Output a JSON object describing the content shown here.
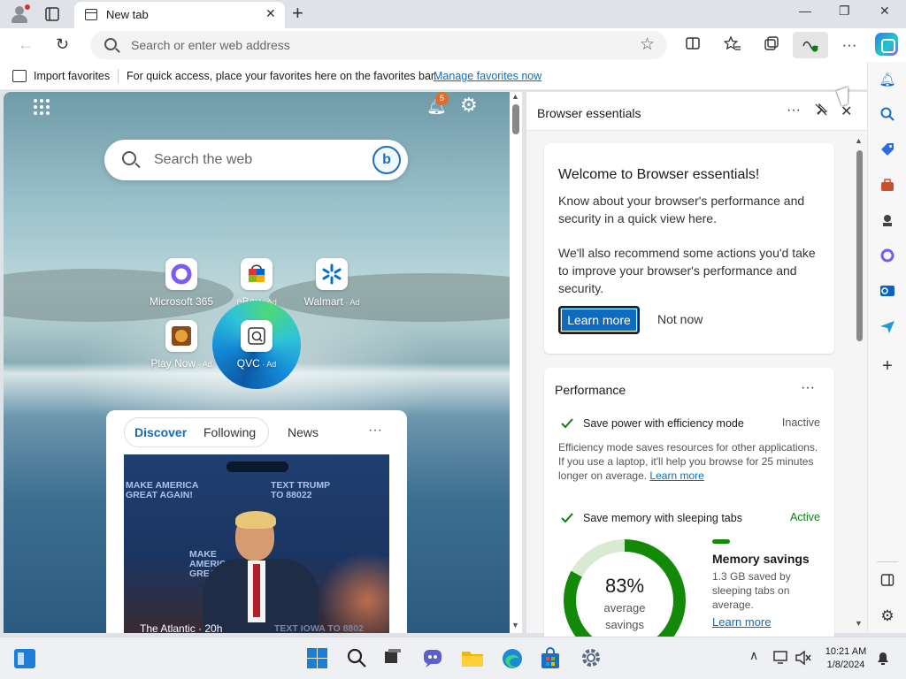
{
  "window": {
    "tab_title": "New tab",
    "new_tab_glyph": "+",
    "close_glyph": "✕",
    "minimize_glyph": "—",
    "maximize_glyph": "❐"
  },
  "toolbar": {
    "back_glyph": "←",
    "refresh_glyph": "↻",
    "address_placeholder": "Search or enter web address",
    "favorite_glyph": "☆",
    "more_glyph": "···"
  },
  "favorites_bar": {
    "import_label": "Import favorites",
    "message": "For quick access, place your favorites here on the favorites bar.",
    "manage_link": "Manage favorites now"
  },
  "new_tab_page": {
    "notification_count": "5",
    "search_placeholder": "Search the web",
    "bing_glyph": "b",
    "quick_links": [
      {
        "label": "Microsoft 365",
        "ad": ""
      },
      {
        "label": "eBay",
        "ad": " · Ad"
      },
      {
        "label": "Walmart",
        "ad": " · Ad"
      },
      {
        "label": "Play Now",
        "ad": " · Ad"
      },
      {
        "label": "QVC",
        "ad": " · Ad"
      }
    ],
    "feed_tabs": [
      "Discover",
      "Following",
      "News"
    ],
    "feed_more": "···",
    "story": {
      "source": "The Atlantic · 20h",
      "poster_1": "MAKE AMERICA GREAT AGAIN!",
      "poster_2": "TEXT TRUMP TO 88022",
      "poster_3": "MAKE AMERICA GREAT A",
      "poster_4": "TEXT IOWA TO 8802"
    }
  },
  "browser_essentials": {
    "title": "Browser essentials",
    "more_glyph": "···",
    "welcome": {
      "title": "Welcome to Browser essentials!",
      "text_1": "Know about your browser's performance and security in a quick view here.",
      "text_2": "We'll also recommend some actions you'd take to improve your browser's performance and security.",
      "learn_more": "Learn more",
      "not_now": "Not now"
    },
    "performance": {
      "title": "Performance",
      "efficiency": {
        "name": "Save power with efficiency mode",
        "status": "Inactive",
        "desc": "Efficiency mode saves resources for other applications. If you use a laptop, it'll help you browse for 25 minutes longer on average.",
        "link": "Learn more"
      },
      "sleeping_tabs": {
        "name": "Save memory with sleeping tabs",
        "status": "Active"
      },
      "memory": {
        "percent": "83%",
        "percent_value": 83,
        "sub_1": "average",
        "sub_2": "savings",
        "title": "Memory savings",
        "desc": "1.3 GB saved by sleeping tabs on average.",
        "link": "Learn more"
      }
    }
  },
  "taskbar": {
    "time": "10:21 AM",
    "date": "1/8/2024"
  },
  "colors": {
    "accent": "#0f6cbd",
    "active_green": "#107c10",
    "ring_green": "#138a07"
  }
}
